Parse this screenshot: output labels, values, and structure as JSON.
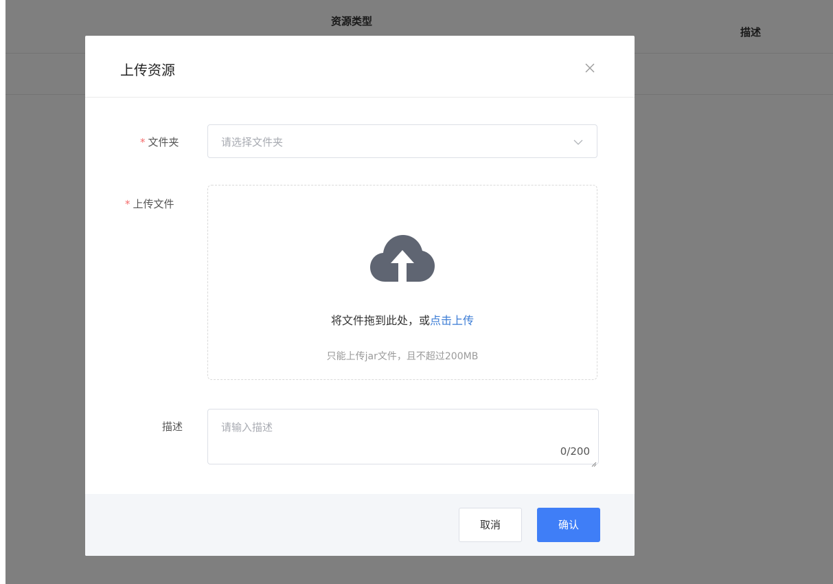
{
  "background": {
    "table_headers": [
      "资源类型",
      "描述"
    ]
  },
  "dialog": {
    "title": "上传资源",
    "close_icon": "close-icon"
  },
  "form": {
    "folder": {
      "required_mark": "*",
      "label": "文件夹",
      "placeholder": "请选择文件夹",
      "icon": "chevron-down-icon"
    },
    "upload": {
      "required_mark": "*",
      "label": "上传文件",
      "icon": "cloud-upload-icon",
      "drag_text": "将文件拖到此处，或",
      "click_text": "点击上传",
      "tip": "只能上传jar文件，且不超过200MB"
    },
    "description": {
      "label": "描述",
      "placeholder": "请输入描述",
      "count": "0/200"
    }
  },
  "footer": {
    "cancel_label": "取消",
    "confirm_label": "确认"
  },
  "colors": {
    "primary": "#3f7ef7",
    "link": "#3a7bd5",
    "required": "#f56c6c",
    "mask": "rgba(0,0,0,0.5)"
  }
}
